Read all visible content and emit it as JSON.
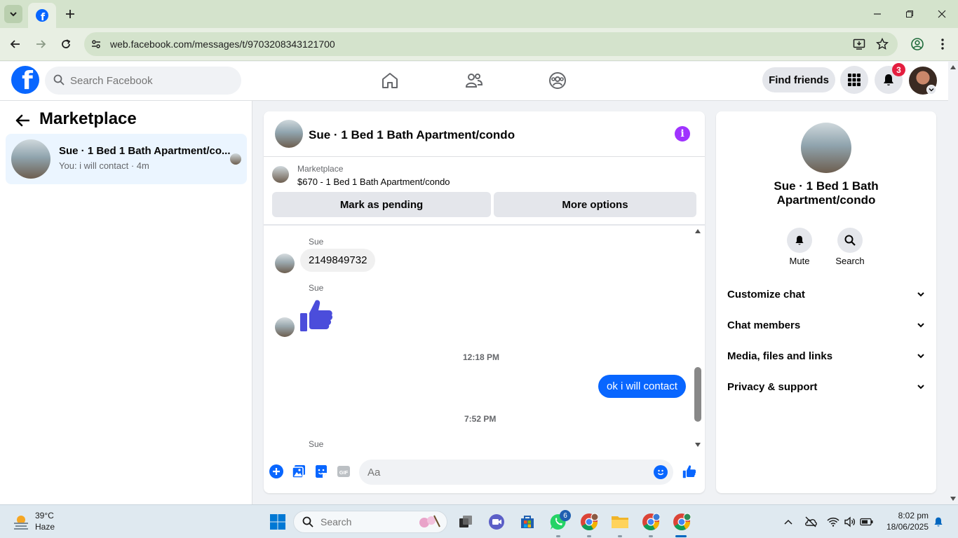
{
  "browser": {
    "url": "web.facebook.com/messages/t/9703208343121700"
  },
  "header": {
    "search_placeholder": "Search Facebook",
    "find_friends": "Find friends",
    "notification_count": "3"
  },
  "left": {
    "title": "Marketplace",
    "conversation": {
      "name": "Sue · 1 Bed 1 Bath Apartment/co...",
      "preview": "You: i will contact · 4m"
    }
  },
  "chat": {
    "title": "Sue · 1 Bed 1 Bath Apartment/condo",
    "listing_label": "Marketplace",
    "listing_title": "$670 - 1 Bed 1 Bath Apartment/condo",
    "mark_pending": "Mark as pending",
    "more_options": "More options",
    "messages": [
      {
        "sender": "Sue",
        "text": "2149849732"
      },
      {
        "sender": "Sue",
        "text": ""
      },
      {
        "timestamp": "12:18 PM"
      },
      {
        "text": "ok i will contact"
      },
      {
        "timestamp": "7:52 PM"
      },
      {
        "sender": "Sue"
      }
    ],
    "composer_placeholder": "Aa"
  },
  "right": {
    "name": "Sue · 1 Bed 1 Bath Apartment/condo",
    "actions": [
      "Mute",
      "Search"
    ],
    "sections": [
      "Customize chat",
      "Chat members",
      "Media, files and links",
      "Privacy & support"
    ]
  },
  "taskbar": {
    "temp": "39°C",
    "weather": "Haze",
    "search_placeholder": "Search",
    "whatsapp_badge": "6",
    "time": "8:02 pm",
    "date": "18/06/2025"
  },
  "colors": {
    "fb_blue": "#0866ff",
    "selected_bg": "#ebf5ff",
    "info_purple": "#a033ff",
    "badge_red": "#e41e3f"
  }
}
